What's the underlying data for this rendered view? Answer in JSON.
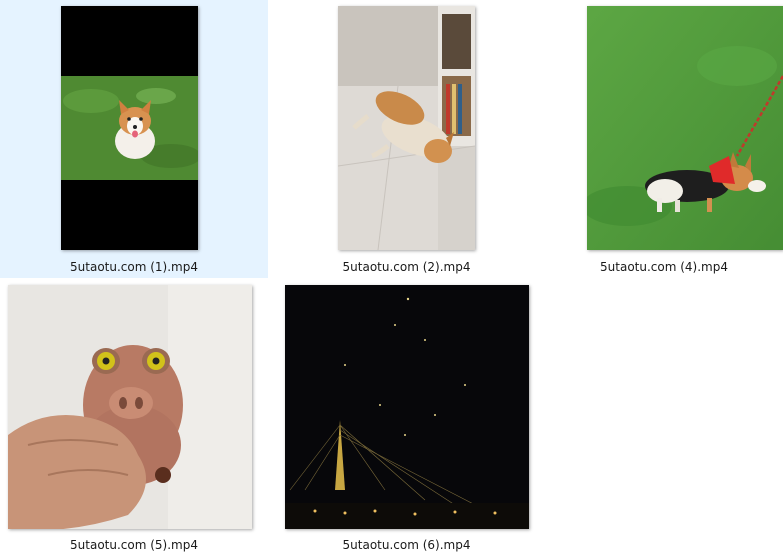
{
  "selection_color": "#e5f3ff",
  "files": [
    {
      "name": "5utaotu.com (1).mp4",
      "thumb": "corgi-sitting-grass",
      "selected": true
    },
    {
      "name": "5utaotu.com (2).mp4",
      "thumb": "corgi-lying-floor",
      "selected": false
    },
    {
      "name": "5utaotu.com (4).mp4",
      "thumb": "corgi-on-leash-lawn",
      "selected": false
    },
    {
      "name": "5utaotu.com (5).mp4",
      "thumb": "pig-squeeze-toy-in-hand",
      "selected": false
    },
    {
      "name": "5utaotu.com (6).mp4",
      "thumb": "night-sky-bridge",
      "selected": false
    }
  ]
}
